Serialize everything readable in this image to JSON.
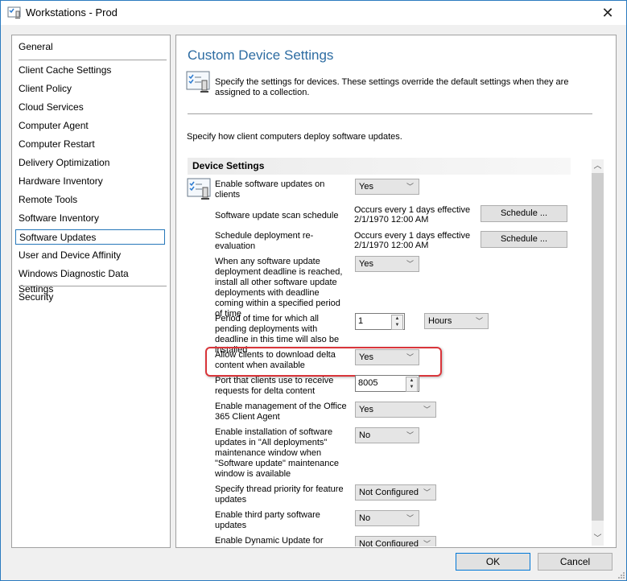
{
  "window": {
    "title": "Workstations - Prod",
    "close_label": "✕"
  },
  "nav": {
    "items": [
      {
        "label": "General"
      },
      {
        "label": "Client Cache Settings"
      },
      {
        "label": "Client Policy"
      },
      {
        "label": "Cloud Services"
      },
      {
        "label": "Computer Agent"
      },
      {
        "label": "Computer Restart"
      },
      {
        "label": "Delivery Optimization"
      },
      {
        "label": "Hardware Inventory"
      },
      {
        "label": "Remote Tools"
      },
      {
        "label": "Software Inventory"
      },
      {
        "label": "Software Updates",
        "selected": true
      },
      {
        "label": "User and Device Affinity"
      },
      {
        "label": "Windows Diagnostic Data Settings"
      },
      {
        "label": "Security"
      }
    ]
  },
  "main": {
    "title": "Custom Device Settings",
    "description": "Specify the settings for devices. These settings override the default settings when they are assigned to a collection.",
    "intro": "Specify how client computers deploy software updates.",
    "group_header": "Device Settings",
    "settings": {
      "enable_updates": {
        "label": "Enable software updates on clients",
        "value": "Yes"
      },
      "scan_schedule": {
        "label": "Software update scan schedule",
        "line1": "Occurs every 1 days effective",
        "line2": "2/1/1970 12:00 AM",
        "button": "Schedule ..."
      },
      "reeval_schedule": {
        "label": "Schedule deployment re-evaluation",
        "line1": "Occurs every 1 days effective",
        "line2": "2/1/1970 12:00 AM",
        "button": "Schedule ..."
      },
      "deadline_install": {
        "label": "When any software update deployment deadline is reached, install all other software update deployments with deadline coming within a specified period of time",
        "value": "Yes"
      },
      "period": {
        "label": "Period of time for which all pending deployments with deadline in this time will also be installed",
        "value": "1",
        "unit": "Hours"
      },
      "delta": {
        "label": "Allow clients to download delta content when available",
        "value": "Yes"
      },
      "port": {
        "label": "Port that clients use to receive requests for delta content",
        "value": "8005"
      },
      "office365": {
        "label": "Enable management of the Office 365 Client Agent",
        "value": "Yes"
      },
      "all_deployments_window": {
        "label": "Enable installation of software updates in \"All deployments\" maintenance window when \"Software update\" maintenance window is available",
        "value": "No"
      },
      "thread_priority": {
        "label": "Specify thread priority for feature updates",
        "value": "Not Configured"
      },
      "third_party": {
        "label": "Enable third party software updates",
        "value": "No"
      },
      "dynamic_update": {
        "label": "Enable Dynamic Update for",
        "value": "Not Configured"
      }
    }
  },
  "footer": {
    "ok": "OK",
    "cancel": "Cancel"
  },
  "colors": {
    "accent": "#0078d7",
    "title_blue": "#2d6ca2",
    "highlight_red": "#d9353a"
  }
}
